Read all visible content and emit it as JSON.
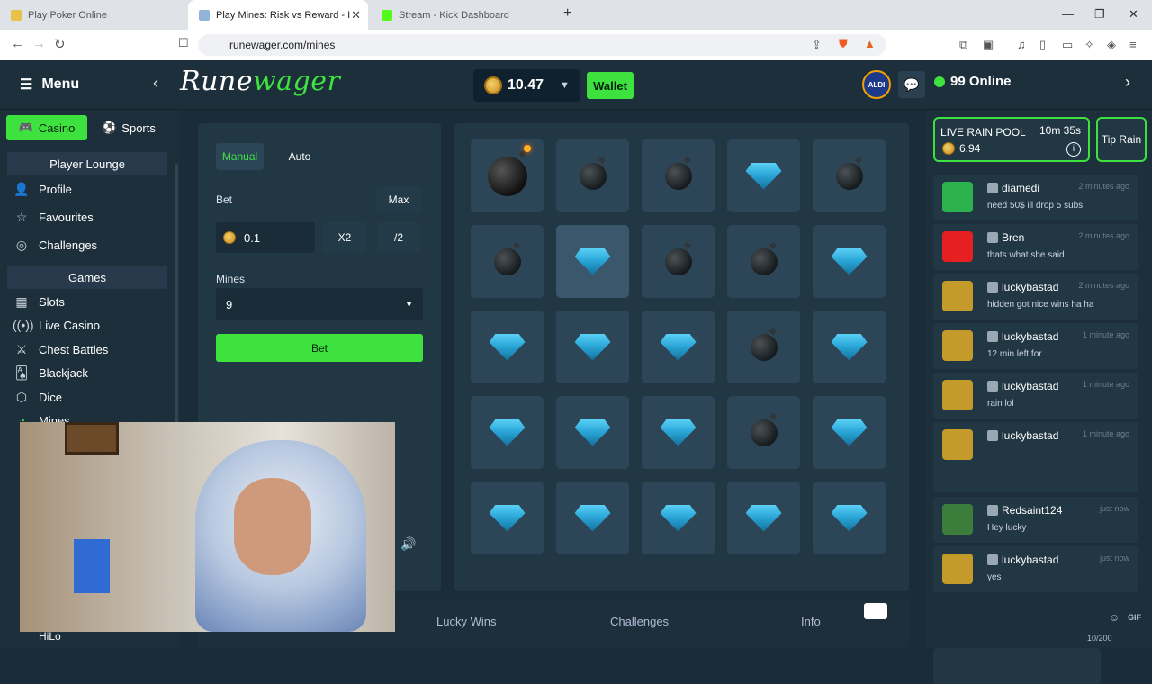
{
  "browser": {
    "tabs": [
      {
        "title": "Play Poker Online",
        "fav": "#e8c04a"
      },
      {
        "title": "Play Mines: Risk vs Reward - I",
        "fav": "#8fb3d9"
      },
      {
        "title": "Stream - Kick Dashboard",
        "fav": "#53fc18"
      }
    ],
    "url": "runewager.com/mines"
  },
  "topbar": {
    "menu_label": "Menu",
    "logo_rune": "Rune",
    "logo_wager": "wager",
    "balance": "10.47",
    "wallet_label": "Wallet",
    "avatar_text": "ALDI",
    "online": "99 Online"
  },
  "sidebar": {
    "casino_label": "Casino",
    "sports_label": "Sports",
    "lounge_header": "Player Lounge",
    "lounge_items": [
      {
        "label": "Profile",
        "icon": "person-icon"
      },
      {
        "label": "Favourites",
        "icon": "star-icon"
      },
      {
        "label": "Challenges",
        "icon": "target-icon"
      }
    ],
    "games_header": "Games",
    "game_items": [
      {
        "label": "Slots",
        "icon": "slots-icon"
      },
      {
        "label": "Live Casino",
        "icon": "broadcast-icon"
      },
      {
        "label": "Chest Battles",
        "icon": "swords-icon"
      },
      {
        "label": "Blackjack",
        "icon": "cards-icon"
      },
      {
        "label": "Dice",
        "icon": "dice-icon"
      },
      {
        "label": "Mines",
        "icon": "mines-icon"
      }
    ],
    "hilo_label": "HiLo"
  },
  "bet_panel": {
    "mode_manual": "Manual",
    "mode_auto": "Auto",
    "bet_label": "Bet",
    "max_label": "Max",
    "bet_value": "0.1",
    "x2_label": "X2",
    "half_label": "/2",
    "mines_label": "Mines",
    "mines_value": "9",
    "bet_button": "Bet"
  },
  "board": {
    "tiles": [
      "bomb-exploded",
      "bomb",
      "bomb",
      "gem",
      "bomb",
      "bomb",
      "gem",
      "bomb",
      "bomb",
      "gem",
      "gem",
      "gem",
      "gem",
      "bomb",
      "gem",
      "gem",
      "gem",
      "gem",
      "bomb",
      "gem",
      "gem",
      "gem",
      "gem",
      "gem",
      "gem"
    ]
  },
  "bottom_tabs": [
    "Lucky Wins",
    "Challenges",
    "Info"
  ],
  "rain": {
    "title": "LIVE RAIN POOL",
    "timer": "10m 35s",
    "amount": "6.94",
    "tip_label": "Tip Rain"
  },
  "chat": [
    {
      "user": "diamedi",
      "time": "2 minutes ago",
      "text": "need 50$ ill drop 5 subs",
      "av": "#2bb24c"
    },
    {
      "user": "Bren",
      "time": "2 minutes ago",
      "text": "thats what she said",
      "av": "#e62020"
    },
    {
      "user": "luckybastad",
      "time": "2 minutes ago",
      "text": "hidden got nice wins ha ha",
      "av": "#c49a2a"
    },
    {
      "user": "luckybastad",
      "time": "1 minute ago",
      "text": "12 min left for",
      "av": "#c49a2a"
    },
    {
      "user": "luckybastad",
      "time": "1 minute ago",
      "text": "rain lol",
      "av": "#c49a2a"
    },
    {
      "user": "luckybastad",
      "time": "1 minute ago",
      "text": "",
      "av": "#c49a2a"
    },
    {
      "user": "Redsaint124",
      "time": "just now",
      "text": "Hey lucky",
      "av": "#3c7d3c"
    },
    {
      "user": "luckybastad",
      "time": "just now",
      "text": "yes",
      "av": "#c49a2a"
    }
  ],
  "chat_footer": {
    "gif": "GIF",
    "counter": "10/200"
  }
}
